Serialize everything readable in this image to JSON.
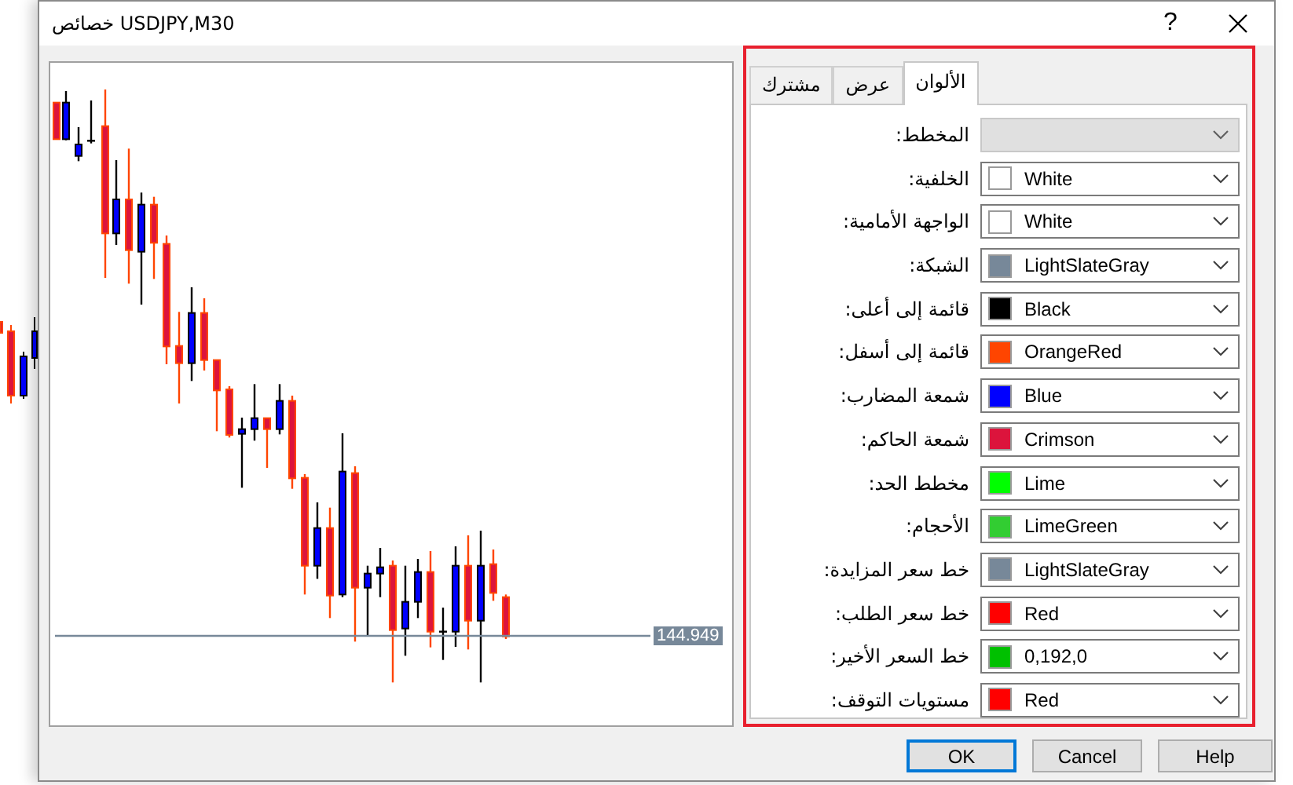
{
  "window": {
    "title": "خصائص USDJPY,M30",
    "help_button": "?"
  },
  "preview": {
    "price_label": "144.949"
  },
  "tabs": [
    {
      "label": "الألوان",
      "selected": true
    },
    {
      "label": "عرض",
      "selected": false
    },
    {
      "label": "مشترك",
      "selected": false
    }
  ],
  "color_settings": [
    {
      "label": "المخطط:",
      "disabled": true
    },
    {
      "label": "الخلفية:",
      "value": "White",
      "color": "#ffffff",
      "disabled": false
    },
    {
      "label": "الواجهة الأمامية:",
      "value": "White",
      "color": "#ffffff",
      "disabled": false
    },
    {
      "label": "الشبكة:",
      "value": "LightSlateGray",
      "color": "#778899",
      "disabled": false
    },
    {
      "label": "قائمة إلى أعلى:",
      "value": "Black",
      "color": "#000000",
      "disabled": false
    },
    {
      "label": "قائمة إلى أسفل:",
      "value": "OrangeRed",
      "color": "#ff4500",
      "disabled": false
    },
    {
      "label": "شمعة المضارب:",
      "value": "Blue",
      "color": "#0000ff",
      "disabled": false
    },
    {
      "label": "شمعة الحاكم:",
      "value": "Crimson",
      "color": "#dc143c",
      "disabled": false
    },
    {
      "label": "مخطط الحد:",
      "value": "Lime",
      "color": "#00ff00",
      "disabled": false
    },
    {
      "label": "الأحجام:",
      "value": "LimeGreen",
      "color": "#32cd32",
      "disabled": false
    },
    {
      "label": "خط سعر المزايدة:",
      "value": "LightSlateGray",
      "color": "#778899",
      "disabled": false
    },
    {
      "label": "خط سعر الطلب:",
      "value": "Red",
      "color": "#ff0000",
      "disabled": false
    },
    {
      "label": "خط السعر الأخير:",
      "value": "0,192,0",
      "color": "#00c000",
      "disabled": false
    },
    {
      "label": "مستويات التوقف:",
      "value": "Red",
      "color": "#ff0000",
      "disabled": false
    }
  ],
  "buttons": [
    {
      "label": "Help",
      "default": false
    },
    {
      "label": "Cancel",
      "default": false
    },
    {
      "label": "OK",
      "default": true
    }
  ]
}
